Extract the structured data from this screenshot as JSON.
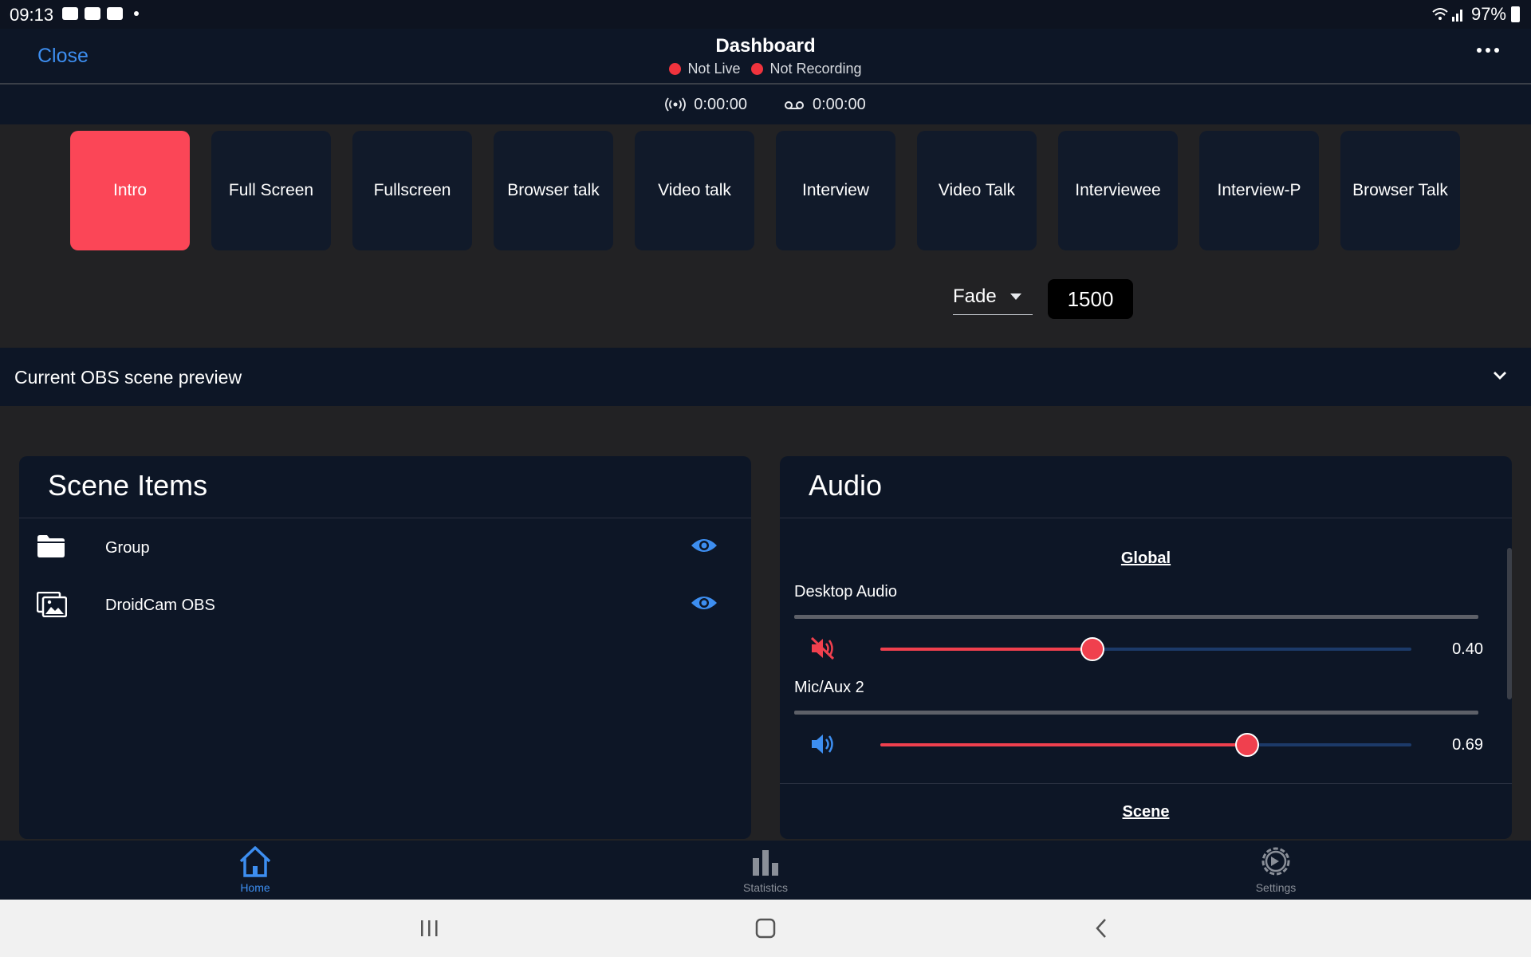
{
  "status_bar": {
    "time": "09:13",
    "battery": "97%"
  },
  "header": {
    "close_label": "Close",
    "title": "Dashboard",
    "live_status": "Not Live",
    "recording_status": "Not Recording",
    "live_color": "#f0333d"
  },
  "timers": {
    "stream_time": "0:00:00",
    "record_time": "0:00:00"
  },
  "scenes": [
    {
      "label": "Intro",
      "active": true
    },
    {
      "label": "Full Screen"
    },
    {
      "label": "Fullscreen"
    },
    {
      "label": "Browser talk"
    },
    {
      "label": "Video talk"
    },
    {
      "label": "Interview"
    },
    {
      "label": "Video Talk"
    },
    {
      "label": "Interviewee"
    },
    {
      "label": "Interview-P"
    },
    {
      "label": "Browser Talk"
    }
  ],
  "transition": {
    "type": "Fade",
    "duration": "1500"
  },
  "preview": {
    "label": "Current OBS scene preview"
  },
  "scene_items": {
    "title": "Scene Items",
    "items": [
      {
        "name": "Group",
        "icon": "folder-icon",
        "visible": true
      },
      {
        "name": "DroidCam OBS",
        "icon": "image-source-icon",
        "visible": true
      }
    ]
  },
  "audio": {
    "title": "Audio",
    "global_label": "Global",
    "scene_label": "Scene",
    "sources": [
      {
        "name": "Desktop Audio",
        "volume": "0.40",
        "level": 0.4,
        "muted": true
      },
      {
        "name": "Mic/Aux 2",
        "volume": "0.69",
        "level": 0.69,
        "muted": false
      }
    ]
  },
  "bottom_nav": {
    "items": [
      {
        "label": "Home",
        "icon": "home-icon",
        "active": true
      },
      {
        "label": "Statistics",
        "icon": "bar-chart-icon"
      },
      {
        "label": "Settings",
        "icon": "gear-icon"
      }
    ]
  },
  "colors": {
    "accent": "#3d8ef0",
    "active_scene": "#fb4657",
    "slider": "#f0404e"
  }
}
